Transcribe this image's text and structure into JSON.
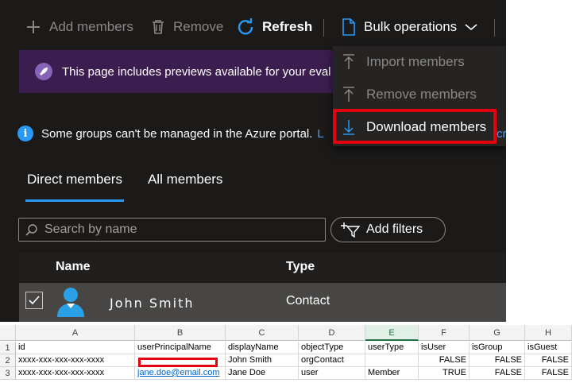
{
  "toolbar": {
    "add_members": "Add members",
    "remove": "Remove",
    "refresh": "Refresh",
    "bulk_operations": "Bulk operations"
  },
  "banner": {
    "text": "This page includes previews available for your eval"
  },
  "info": {
    "text": "Some groups can't be managed in the Azure portal.",
    "link": "L"
  },
  "dropdown": {
    "import": "Import members",
    "remove": "Remove members",
    "download": "Download members",
    "overflow_text": "cro"
  },
  "tabs": {
    "direct": "Direct members",
    "all": "All members"
  },
  "search": {
    "placeholder": "Search by name"
  },
  "filters": {
    "label": "Add filters"
  },
  "table": {
    "headers": {
      "name": "Name",
      "type": "Type"
    },
    "row": {
      "name": "John Smith",
      "type": "Contact"
    }
  },
  "sheet": {
    "columns": [
      "A",
      "B",
      "C",
      "D",
      "E",
      "F",
      "G",
      "H"
    ],
    "rows": [
      "1",
      "2",
      "3"
    ],
    "selected_column": "E",
    "data": [
      [
        "id",
        "userPrincipalName",
        "displayName",
        "objectType",
        "userType",
        "isUser",
        "isGroup",
        "isGuest"
      ],
      [
        "xxxx-xxx-xxx-xxx-xxxx",
        "",
        "John Smith",
        "orgContact",
        "",
        "FALSE",
        "FALSE",
        "FALSE"
      ],
      [
        "xxxx-xxx-xxx-xxx-xxxx",
        "jane.doe@email.com",
        "Jane Doe",
        "user",
        "Member",
        "TRUE",
        "FALSE",
        "FALSE"
      ]
    ]
  },
  "colors": {
    "accent": "#2899f5",
    "highlight": "#e3000f",
    "excel_green": "#217346"
  }
}
